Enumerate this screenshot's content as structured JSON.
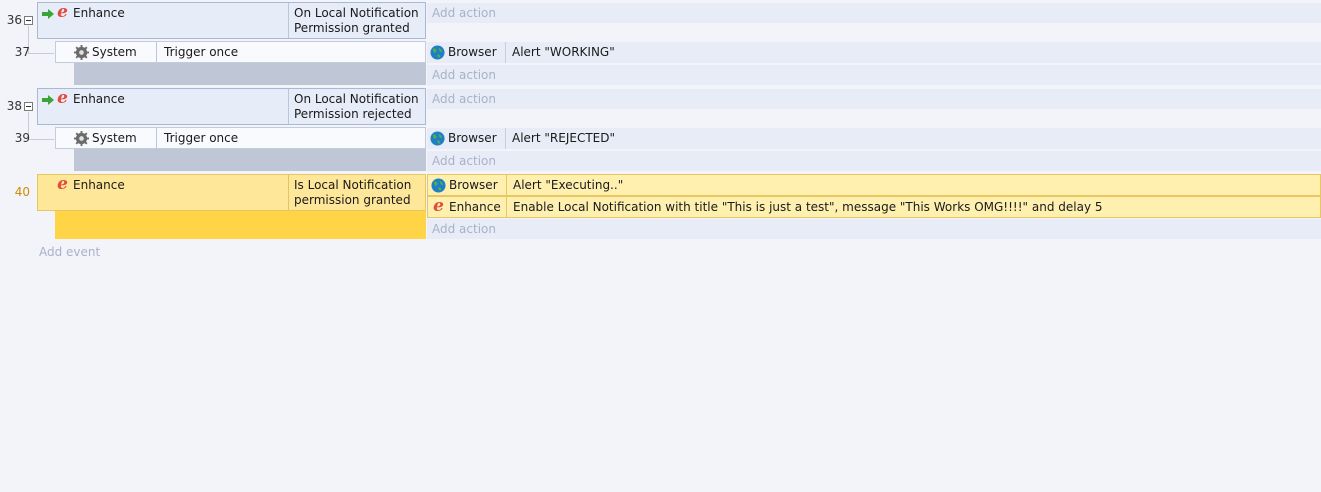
{
  "events": [
    {
      "number": "36",
      "object": "Enhance",
      "condition": [
        "On Local Notification",
        "Permission granted"
      ],
      "add_action": "Add action",
      "sub": {
        "number": "37",
        "object": "System",
        "condition": "Trigger once",
        "action_object": "Browser",
        "action": "Alert \"WORKING\"",
        "add_action": "Add action"
      }
    },
    {
      "number": "38",
      "object": "Enhance",
      "condition": [
        "On Local Notification",
        "Permission rejected"
      ],
      "add_action": "Add action",
      "sub": {
        "number": "39",
        "object": "System",
        "condition": "Trigger once",
        "action_object": "Browser",
        "action": "Alert \"REJECTED\"",
        "add_action": "Add action"
      }
    },
    {
      "number": "40",
      "object": "Enhance",
      "condition": [
        "Is Local Notification",
        "permission granted"
      ],
      "actions": [
        {
          "object": "Browser",
          "text": "Alert \"Executing..\""
        },
        {
          "object": "Enhance",
          "text": "Enable Local Notification with title \"This is just a test\", message \"This Works OMG!!!!\" and delay 5"
        }
      ],
      "add_action": "Add action"
    }
  ],
  "add_event": "Add event",
  "colors": {
    "background": "#f3f4fa",
    "selected": "#ffe79a",
    "selected_accent": "#ffd447",
    "enhance_icon": "#e24a3b"
  },
  "icons": {
    "trigger": "green-arrow-icon",
    "enhance": "enhance-e-icon",
    "system": "gear-icon",
    "browser": "globe-icon",
    "collapse": "collapse-minus-icon"
  }
}
